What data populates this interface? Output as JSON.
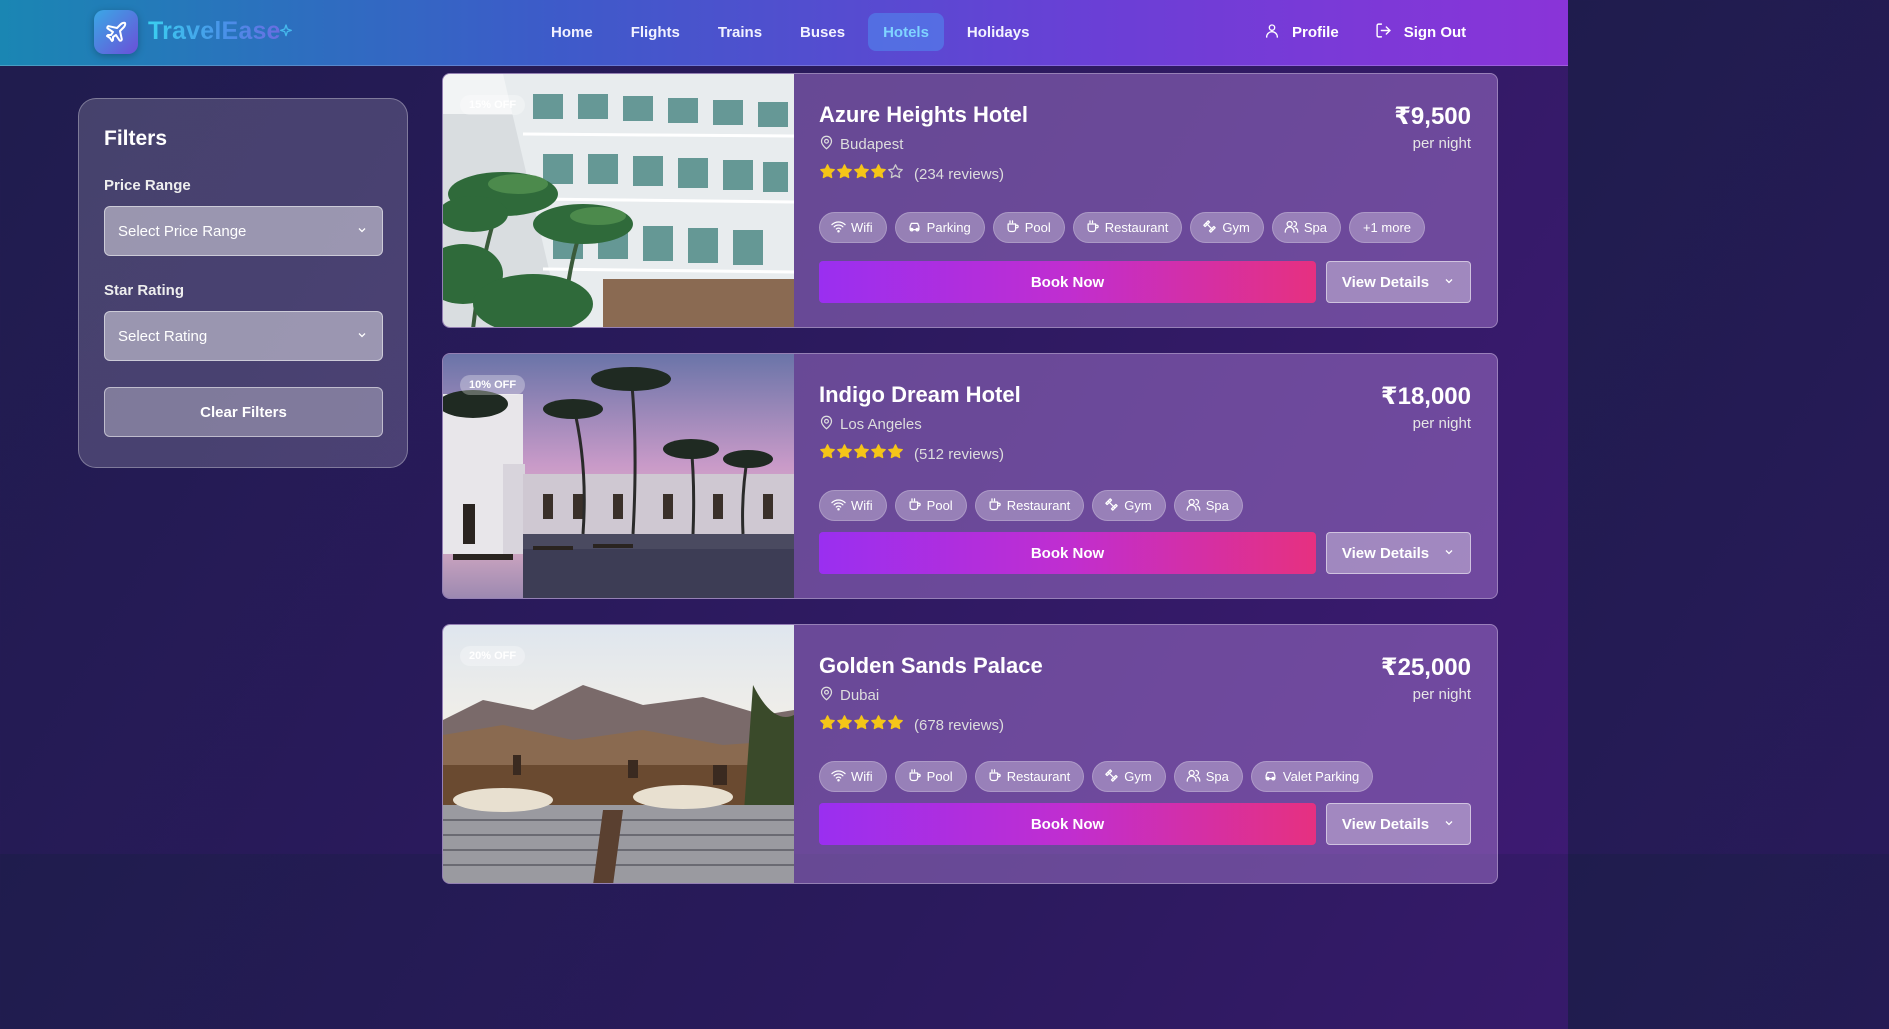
{
  "header": {
    "brand": "TravelEase",
    "nav": [
      "Home",
      "Flights",
      "Trains",
      "Buses",
      "Hotels",
      "Holidays"
    ],
    "active_nav": "Hotels",
    "profile": "Profile",
    "signout": "Sign Out"
  },
  "filters": {
    "title": "Filters",
    "price_label": "Price Range",
    "price_placeholder": "Select Price Range",
    "rating_label": "Star Rating",
    "rating_placeholder": "Select Rating",
    "clear": "Clear Filters"
  },
  "hotels": [
    {
      "name": "Azure Heights Hotel",
      "location": "Budapest",
      "rating": 4,
      "reviews": "(234 reviews)",
      "price": "₹9,500",
      "per_night": "per night",
      "discount": "15% OFF",
      "amenities": [
        "Wifi",
        "Parking",
        "Pool",
        "Restaurant",
        "Gym",
        "Spa"
      ],
      "more": "+1 more",
      "book": "Book Now",
      "details": "View Details"
    },
    {
      "name": "Indigo Dream Hotel",
      "location": "Los Angeles",
      "rating": 5,
      "reviews": "(512 reviews)",
      "price": "₹18,000",
      "per_night": "per night",
      "discount": "10% OFF",
      "amenities": [
        "Wifi",
        "Pool",
        "Restaurant",
        "Gym",
        "Spa"
      ],
      "book": "Book Now",
      "details": "View Details"
    },
    {
      "name": "Golden Sands Palace",
      "location": "Dubai",
      "rating": 5,
      "reviews": "(678 reviews)",
      "price": "₹25,000",
      "per_night": "per night",
      "discount": "20% OFF",
      "amenities": [
        "Wifi",
        "Pool",
        "Restaurant",
        "Gym",
        "Spa",
        "Valet Parking"
      ],
      "book": "Book Now",
      "details": "View Details"
    }
  ],
  "colors": {
    "accent": "#7fd4ff",
    "star": "#f5c518",
    "book_start": "#9a2ff0",
    "book_end": "#e63080"
  }
}
